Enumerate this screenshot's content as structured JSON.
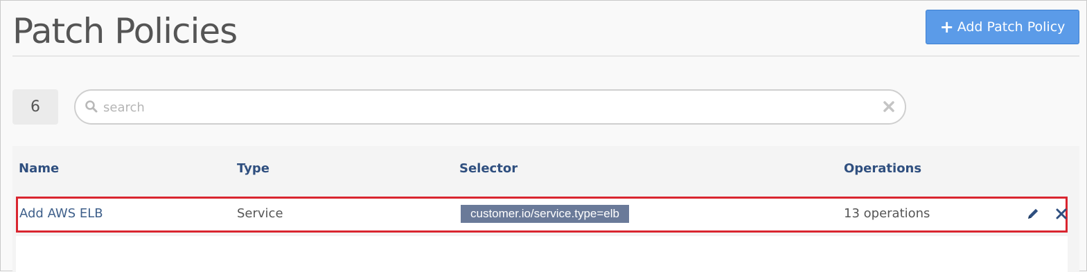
{
  "header": {
    "title": "Patch Policies",
    "add_button_label": "Add Patch Policy",
    "add_button_icon": "plus-icon"
  },
  "filter": {
    "count": "6",
    "search_placeholder": "search",
    "search_value": ""
  },
  "table": {
    "columns": [
      "Name",
      "Type",
      "Selector",
      "Operations"
    ],
    "rows": [
      {
        "name": "Add AWS ELB",
        "type": "Service",
        "selector": "customer.io/service.type=elb",
        "operations": "13 operations",
        "highlighted": true
      }
    ]
  },
  "colors": {
    "accent": "#5b9be8",
    "header_text": "#2f4f7f",
    "highlight_border": "#d9252f",
    "selector_tag": "#6a7a99"
  },
  "icons": {
    "search": "search-icon",
    "clear": "clear-icon",
    "edit": "pencil-icon",
    "delete": "close-icon"
  }
}
